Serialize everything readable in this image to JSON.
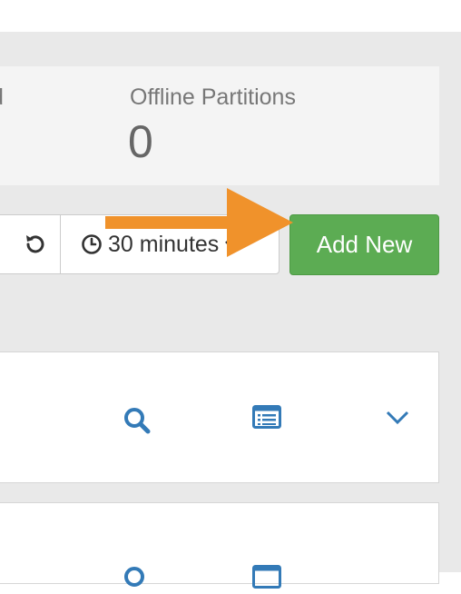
{
  "stats": {
    "clipped_label": "d",
    "offline_partitions_label": "Offline Partitions",
    "offline_partitions_value": "0"
  },
  "toolbar": {
    "time_range_label": "30 minutes",
    "add_new_label": "Add New"
  },
  "colors": {
    "add_button": "#5cac53",
    "icon_blue": "#337ab7",
    "arrow_orange": "#f0922b",
    "background": "#e9e9e9"
  },
  "icons": [
    "refresh-icon",
    "clock-icon",
    "caret-down-icon",
    "search-icon",
    "list-icon",
    "chevron-down-icon"
  ]
}
